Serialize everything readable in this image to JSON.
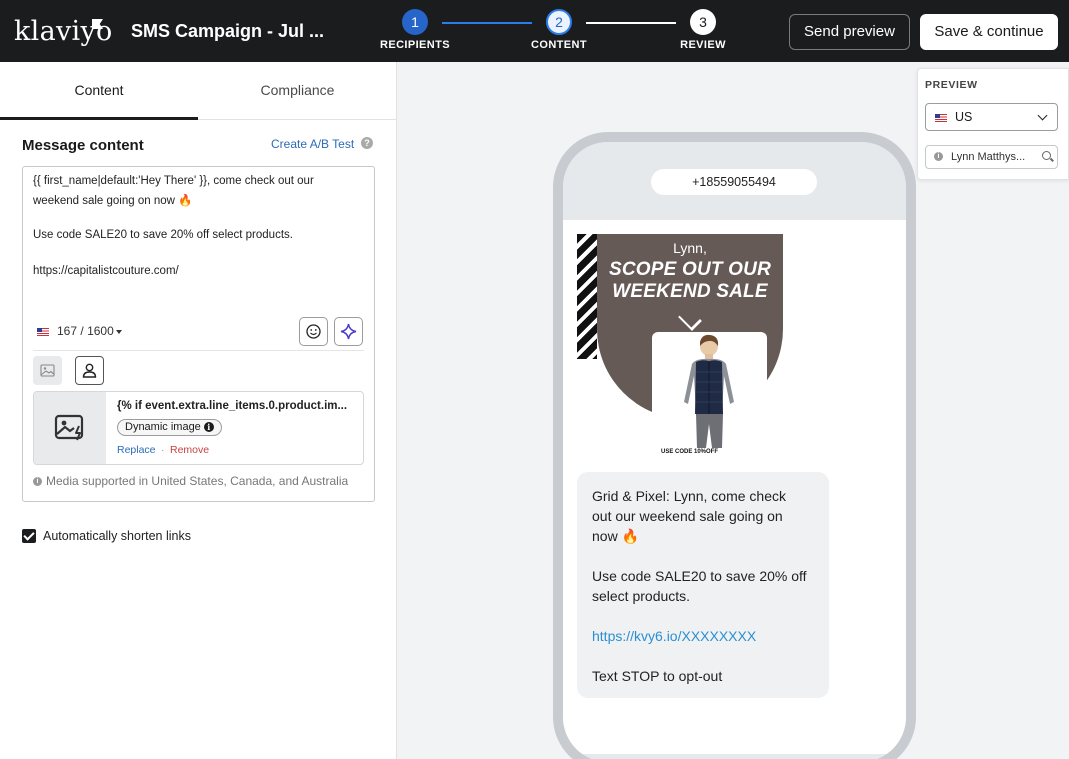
{
  "header": {
    "logo": "klaviyo",
    "campaign_title": "SMS Campaign - Jul ...",
    "steps": [
      {
        "number": "1",
        "label": "RECIPIENTS"
      },
      {
        "number": "2",
        "label": "CONTENT"
      },
      {
        "number": "3",
        "label": "REVIEW"
      }
    ],
    "send_preview_label": "Send preview",
    "save_continue_label": "Save & continue"
  },
  "tabs": [
    {
      "label": "Content",
      "active": true
    },
    {
      "label": "Compliance",
      "active": false
    }
  ],
  "editor": {
    "section_title": "Message content",
    "ab_test_link": "Create A/B Test",
    "help": "?",
    "message_lines": [
      "{{ first_name|default:'Hey There' }}, come check out our",
      "weekend sale going on now 🔥",
      "Use code SALE20 to save 20% off select products.",
      "https://capitalistcouture.com/"
    ],
    "char_count": "167",
    "char_sep": "/",
    "char_limit": "1600",
    "media": {
      "title": "{% if event.extra.line_items.0.product.im...",
      "badge": "Dynamic image",
      "replace": "Replace",
      "separator": "·",
      "remove": "Remove"
    },
    "media_note": "Media supported in United States, Canada, and Australia",
    "shorten_links_label": "Automatically shorten links",
    "shorten_links_checked": true
  },
  "phone": {
    "number": "+18559055494",
    "mms": {
      "greeting": "Lynn,",
      "headline_1": "SCOPE OUT OUR",
      "headline_2": "WEEKEND SALE",
      "code_text": "USE CODE 10%OFF",
      "bg_color": "#665a57"
    },
    "sms_lines": [
      "Grid & Pixel: Lynn, come check",
      "out our weekend sale going on",
      "now 🔥",
      "Use code SALE20 to save 20% off",
      "select products.",
      "https://kvy6.io/XXXXXXXX",
      "Text STOP to opt-out"
    ]
  },
  "preview": {
    "label": "PREVIEW",
    "country": "US",
    "profile": "Lynn Matthys..."
  },
  "colors": {
    "topbar": "#1b1c1e",
    "step_active": "#2665c9",
    "link": "#2b6bb8",
    "remove": "#c7423f",
    "sms_link": "#2b8fd1"
  }
}
